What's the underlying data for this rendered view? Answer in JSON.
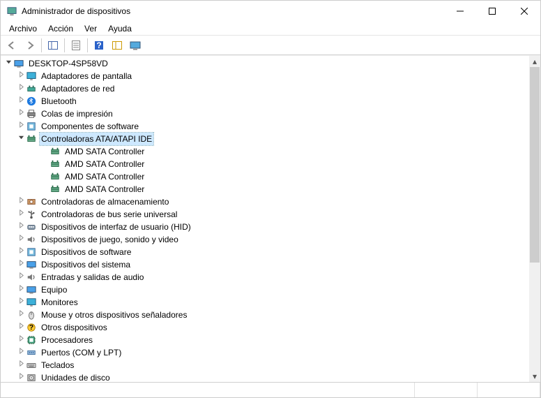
{
  "window": {
    "title": "Administrador de dispositivos"
  },
  "menu": {
    "file": "Archivo",
    "action": "Acción",
    "view": "Ver",
    "help": "Ayuda"
  },
  "tree": {
    "root": "DESKTOP-4SP58VD",
    "items": [
      {
        "label": "Adaptadores de pantalla",
        "icon": "display-adapter-icon",
        "expandable": true
      },
      {
        "label": "Adaptadores de red",
        "icon": "network-adapter-icon",
        "expandable": true
      },
      {
        "label": "Bluetooth",
        "icon": "bluetooth-icon",
        "expandable": true
      },
      {
        "label": "Colas de impresión",
        "icon": "print-queue-icon",
        "expandable": true
      },
      {
        "label": "Componentes de software",
        "icon": "software-component-icon",
        "expandable": true
      },
      {
        "label": "Controladoras ATA/ATAPI IDE",
        "icon": "ide-controller-icon",
        "expandable": true,
        "expanded": true,
        "selected": true,
        "children": [
          {
            "label": "AMD SATA Controller",
            "icon": "ide-controller-icon"
          },
          {
            "label": "AMD SATA Controller",
            "icon": "ide-controller-icon"
          },
          {
            "label": "AMD SATA Controller",
            "icon": "ide-controller-icon"
          },
          {
            "label": "AMD SATA Controller",
            "icon": "ide-controller-icon"
          }
        ]
      },
      {
        "label": "Controladoras de almacenamiento",
        "icon": "storage-controller-icon",
        "expandable": true
      },
      {
        "label": "Controladoras de bus serie universal",
        "icon": "usb-controller-icon",
        "expandable": true
      },
      {
        "label": "Dispositivos de interfaz de usuario (HID)",
        "icon": "hid-icon",
        "expandable": true
      },
      {
        "label": "Dispositivos de juego, sonido y video",
        "icon": "sound-video-game-icon",
        "expandable": true
      },
      {
        "label": "Dispositivos de software",
        "icon": "software-device-icon",
        "expandable": true
      },
      {
        "label": "Dispositivos del sistema",
        "icon": "system-device-icon",
        "expandable": true
      },
      {
        "label": "Entradas y salidas de audio",
        "icon": "audio-io-icon",
        "expandable": true
      },
      {
        "label": "Equipo",
        "icon": "computer-icon",
        "expandable": true
      },
      {
        "label": "Monitores",
        "icon": "monitor-icon",
        "expandable": true
      },
      {
        "label": "Mouse y otros dispositivos señaladores",
        "icon": "mouse-icon",
        "expandable": true
      },
      {
        "label": "Otros dispositivos",
        "icon": "other-device-icon",
        "expandable": true
      },
      {
        "label": "Procesadores",
        "icon": "processor-icon",
        "expandable": true
      },
      {
        "label": "Puertos (COM y LPT)",
        "icon": "port-icon",
        "expandable": true
      },
      {
        "label": "Teclados",
        "icon": "keyboard-icon",
        "expandable": true
      },
      {
        "label": "Unidades de disco",
        "icon": "disk-drive-icon",
        "expandable": true
      }
    ]
  }
}
